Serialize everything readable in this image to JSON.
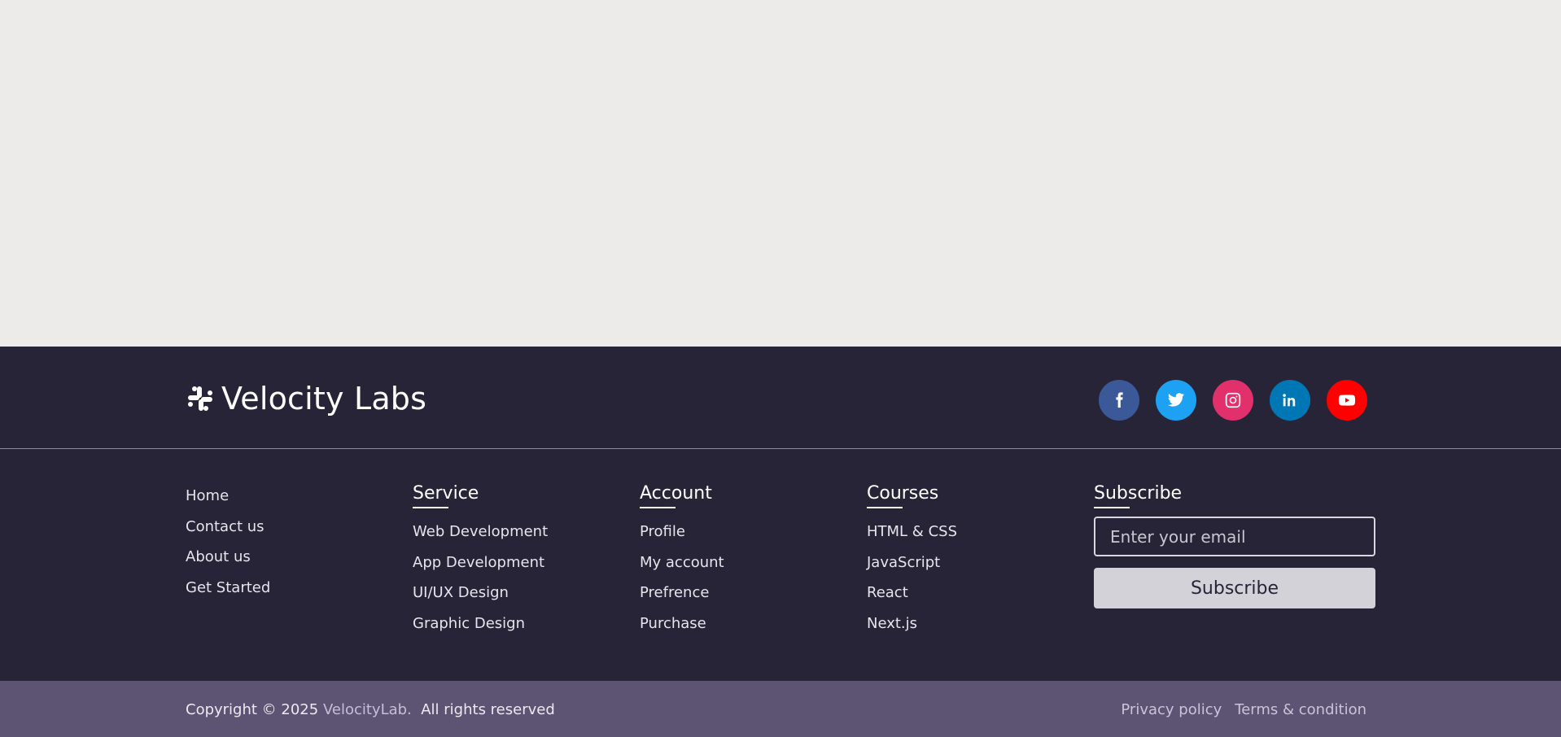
{
  "brand": {
    "name": "Velocity Labs",
    "icon": "slack-icon"
  },
  "socials": [
    {
      "name": "facebook",
      "icon": "facebook-icon",
      "color": "#3b5998"
    },
    {
      "name": "twitter",
      "icon": "twitter-icon",
      "color": "#1da1f2"
    },
    {
      "name": "instagram",
      "icon": "instagram-icon",
      "color": "#e1306c"
    },
    {
      "name": "linkedin",
      "icon": "linkedin-icon",
      "color": "#0077b5"
    },
    {
      "name": "youtube",
      "icon": "youtube-icon",
      "color": "#ff0000"
    }
  ],
  "links": [
    "Home",
    "Contact us",
    "About us",
    "Get Started"
  ],
  "service": {
    "title": "Service",
    "items": [
      "Web Development",
      "App Development",
      "UI/UX Design",
      "Graphic Design"
    ]
  },
  "account": {
    "title": "Account",
    "items": [
      "Profile",
      "My account",
      "Prefrence",
      "Purchase"
    ]
  },
  "courses": {
    "title": "Courses",
    "items": [
      "HTML & CSS",
      "JavaScript",
      "React",
      "Next.js"
    ]
  },
  "subscribe": {
    "title": "Subscribe",
    "placeholder": "Enter your email",
    "button": "Subscribe"
  },
  "bottom": {
    "copyright": "Copyright © 2025",
    "company": "VelocityLab.",
    "rights": "All rights reserved",
    "privacy": "Privacy policy",
    "terms": "Terms & condition"
  },
  "colors": {
    "footer_bg": "#282438",
    "bottom_bg": "#5c5472",
    "page_bg": "#ecebe9"
  }
}
